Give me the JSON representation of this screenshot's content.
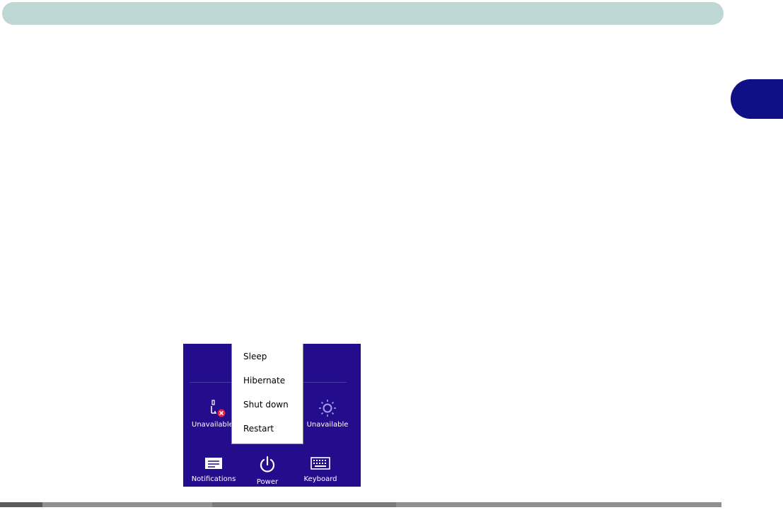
{
  "settings_charm": {
    "tiles": [
      {
        "label": "Unavailable",
        "icon": "network-unavailable-icon"
      },
      {
        "label": "Unavailable",
        "icon": "brightness-icon"
      },
      {
        "label": "Notifications",
        "icon": "notifications-icon"
      },
      {
        "label": "Power",
        "icon": "power-icon"
      },
      {
        "label": "Keyboard",
        "icon": "keyboard-icon"
      }
    ],
    "background_color": "#240d8c"
  },
  "power_menu": {
    "items": [
      "Sleep",
      "Hibernate",
      "Shut down",
      "Restart"
    ]
  },
  "page": {
    "header_color": "#bdd7d5",
    "chapter_tab_color": "#100f86"
  }
}
